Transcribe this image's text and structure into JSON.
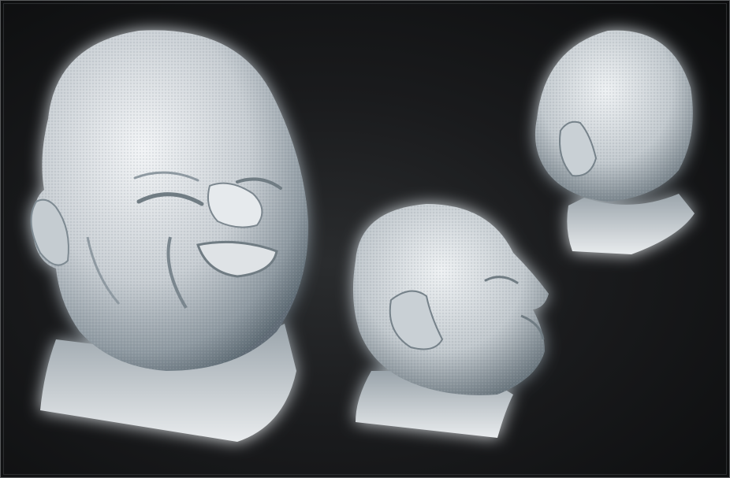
{
  "scene": {
    "subject": "sculpted-head-renders",
    "views": [
      {
        "id": "front-three-quarter"
      },
      {
        "id": "side-profile"
      },
      {
        "id": "back-three-quarter"
      }
    ],
    "colors": {
      "background": "#0e0f10",
      "glow": "#ffffff",
      "clay_light": "#eef1f3",
      "clay_mid": "#b9c0c6",
      "clay_shadow": "#5e6b74"
    }
  }
}
